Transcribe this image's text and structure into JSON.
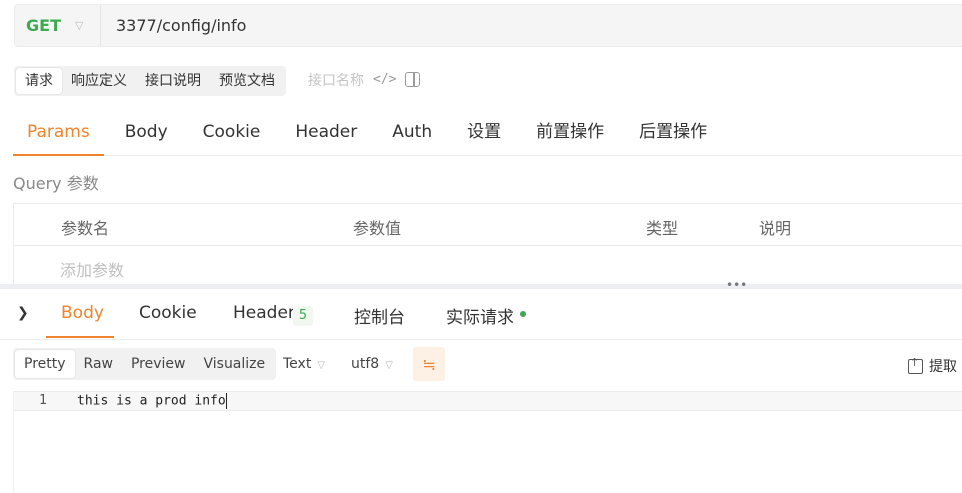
{
  "request": {
    "method": "GET",
    "url": "3377/config/info"
  },
  "mode_tabs": [
    "请求",
    "响应定义",
    "接口说明",
    "预览文档"
  ],
  "api_name_placeholder": "接口名称",
  "code_icon_glyph": "</>",
  "request_tabs": [
    "Params",
    "Body",
    "Cookie",
    "Header",
    "Auth",
    "设置",
    "前置操作",
    "后置操作"
  ],
  "params": {
    "query_label": "Query 参数",
    "columns": [
      "参数名",
      "参数值",
      "类型",
      "说明"
    ],
    "add_placeholder": "添加参数"
  },
  "response": {
    "tabs": [
      "Body",
      "Cookie",
      "Header",
      "控制台",
      "实际请求"
    ],
    "header_count": "5",
    "format_tabs": [
      "Pretty",
      "Raw",
      "Preview",
      "Visualize"
    ],
    "type_select": "Text",
    "encoding_select": "utf8",
    "extract_label": "提取",
    "lines": [
      {
        "number": "1",
        "text": "this is a prod info"
      }
    ]
  },
  "colors": {
    "accent": "#f0832b",
    "method": "#3daa50",
    "status_dot": "#3daa50"
  }
}
